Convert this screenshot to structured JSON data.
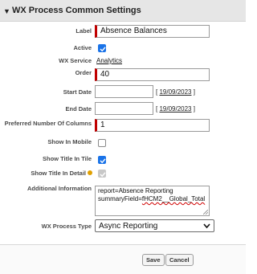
{
  "section": {
    "title": "WX Process Common Settings",
    "caret": "▼"
  },
  "fields": {
    "label": {
      "label": "Label",
      "value": "Absence Balances"
    },
    "active": {
      "label": "Active",
      "checked": true
    },
    "wx_service": {
      "label": "WX Service",
      "value": "Analytics"
    },
    "order": {
      "label": "Order",
      "value": "40"
    },
    "start_date": {
      "label": "Start Date",
      "value": "",
      "hint_open": "[ ",
      "hint_date": "19/09/2023",
      "hint_close": " ]"
    },
    "end_date": {
      "label": "End Date",
      "value": "",
      "hint_open": "[ ",
      "hint_date": "19/09/2023",
      "hint_close": " ]"
    },
    "preferred_columns": {
      "label": "Preferred Number Of Columns",
      "value": "1"
    },
    "show_in_mobile": {
      "label": "Show In Mobile",
      "checked": false
    },
    "show_title_in_tile": {
      "label": "Show Title In Tile",
      "checked": true
    },
    "show_title_in_detail": {
      "label": "Show Title In Detail",
      "checked": true,
      "disabled": true
    },
    "additional_info": {
      "label": "Additional Information",
      "line1": "report=Absence Reporting",
      "line2_prefix": "summaryField=",
      "line2_squiggle": "fHCM2__Global_Total"
    },
    "process_type": {
      "label": "WX Process Type",
      "value": "Async Reporting"
    }
  },
  "buttons": {
    "save": "Save",
    "cancel": "Cancel"
  },
  "colors": {
    "required": "#c00000",
    "checkbox_on": "#1a73e8",
    "header_bg": "#e6e6e6"
  }
}
